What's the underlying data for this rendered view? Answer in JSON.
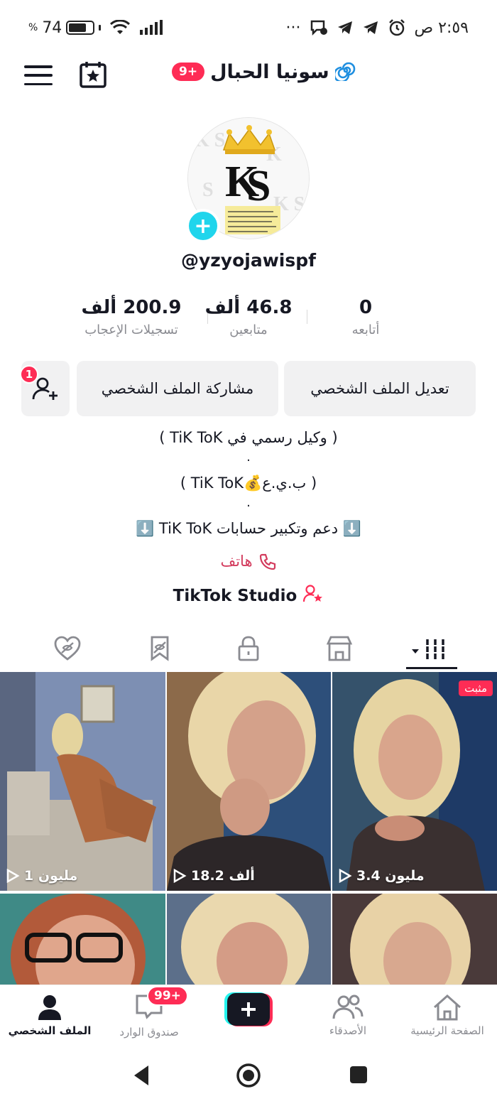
{
  "status_bar": {
    "time": "٢:٥٩ ص",
    "battery": "74",
    "battery_percent_sign": "%",
    "dots": "···",
    "battery_level": 0.74
  },
  "header": {
    "title": "سونيا الحبال",
    "badge": "9+"
  },
  "profile": {
    "username": "@yzyojawispf",
    "stats": [
      {
        "value": "0",
        "label": "أتابعه"
      },
      {
        "value": "46.8 ألف",
        "label": "متابعين"
      },
      {
        "value": "200.9 ألف",
        "label": "تسجيلات الإعجاب"
      }
    ],
    "edit_label": "تعديل الملف الشخصي",
    "share_label": "مشاركة الملف الشخصي",
    "add_friends_badge": "1",
    "bio": {
      "line1": "( وكيل رسمي في TiK ToK )",
      "dot": ".",
      "line2": "( ب.ي.ع💰TiK ToK )",
      "line3": "⬇️ دعم وتكبير حسابات TiK ToK ⬇️"
    },
    "phone_label": "هاتف",
    "studio_label": "TikTok Studio"
  },
  "videos": [
    {
      "views": "3.4 مليون",
      "pinned": "مثبت"
    },
    {
      "views": "18.2 ألف"
    },
    {
      "views": "1 مليون"
    },
    {
      "views": ""
    },
    {
      "views": ""
    },
    {
      "views": ""
    }
  ],
  "bottom_nav": {
    "home": "الصفحة الرئيسية",
    "friends": "الأصدقاء",
    "inbox": "صندوق الوارد",
    "inbox_badge": "99+",
    "profile": "الملف الشخصي"
  },
  "colors": {
    "accent": "#fe2c55",
    "cyan": "#20d5ec",
    "text": "#161823",
    "secondary": "#8a8b91"
  }
}
